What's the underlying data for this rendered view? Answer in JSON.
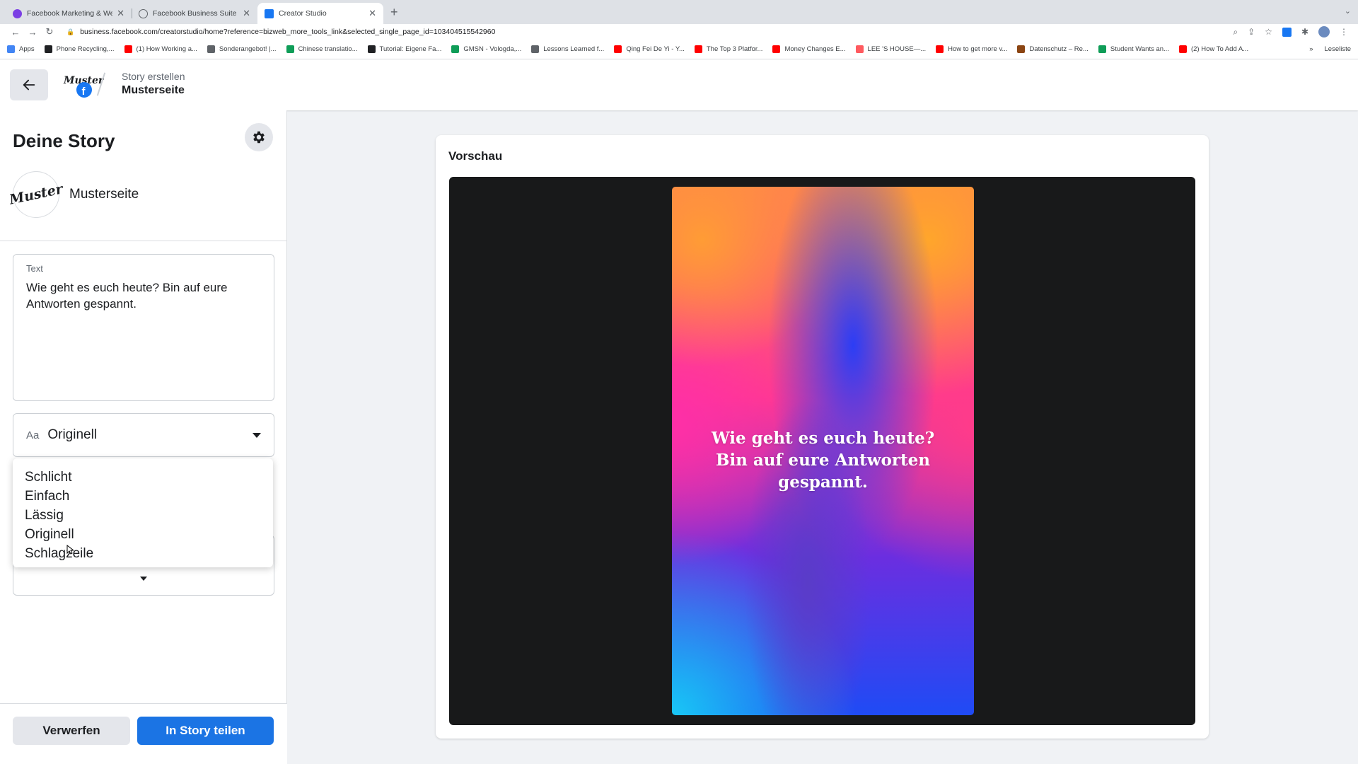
{
  "browser": {
    "tabs": [
      {
        "label": "Facebook Marketing & Werbea",
        "active": false,
        "color": "#7b3fe4"
      },
      {
        "label": "Facebook Business Suite",
        "active": false,
        "color": "#5f6368"
      },
      {
        "label": "Creator Studio",
        "active": true,
        "color": "#1877f2"
      }
    ],
    "url": "business.facebook.com/creatorstudio/home?reference=bizweb_more_tools_link&selected_single_page_id=103404515542960",
    "bookmarks": [
      {
        "label": "Apps",
        "color": "#4285f4"
      },
      {
        "label": "Phone Recycling,...",
        "color": "#202124"
      },
      {
        "label": "(1) How Working a...",
        "color": "#ff0000"
      },
      {
        "label": "Sonderangebot! |...",
        "color": "#5f6368"
      },
      {
        "label": "Chinese translatio...",
        "color": "#0f9d58"
      },
      {
        "label": "Tutorial: Eigene Fa...",
        "color": "#202124"
      },
      {
        "label": "GMSN - Vologda,...",
        "color": "#0f9d58"
      },
      {
        "label": "Lessons Learned f...",
        "color": "#5f6368"
      },
      {
        "label": "Qing Fei De Yi - Y...",
        "color": "#ff0000"
      },
      {
        "label": "The Top 3 Platfor...",
        "color": "#ff0000"
      },
      {
        "label": "Money Changes E...",
        "color": "#ff0000"
      },
      {
        "label": "LEE 'S HOUSE—...",
        "color": "#ff5a5f"
      },
      {
        "label": "How to get more v...",
        "color": "#ff0000"
      },
      {
        "label": "Datenschutz – Re...",
        "color": "#8b4513"
      },
      {
        "label": "Student Wants an...",
        "color": "#0f9d58"
      },
      {
        "label": "(2) How To Add A...",
        "color": "#ff0000"
      }
    ],
    "reading_list": "Leseliste"
  },
  "header": {
    "breadcrumb_top": "Story erstellen",
    "breadcrumb_page": "Musterseite",
    "logo_text": "Muster"
  },
  "panel": {
    "title": "Deine Story",
    "page_name": "Musterseite",
    "avatar_text": "Muster",
    "text_label": "Text",
    "text_value": "Wie geht es euch heute? Bin auf eure Antworten gespannt.",
    "font_prefix": "Aa",
    "font_selected": "Originell",
    "font_options": [
      "Schlicht",
      "Einfach",
      "Lässig",
      "Originell",
      "Schlagzeile"
    ],
    "discard_label": "Verwerfen",
    "share_label": "In Story teilen"
  },
  "preview": {
    "title": "Vorschau",
    "story_text": "Wie geht es euch heute? Bin auf eure Antworten gespannt."
  },
  "colors": {
    "accent": "#1b74e4",
    "brand": "#1877f2"
  }
}
